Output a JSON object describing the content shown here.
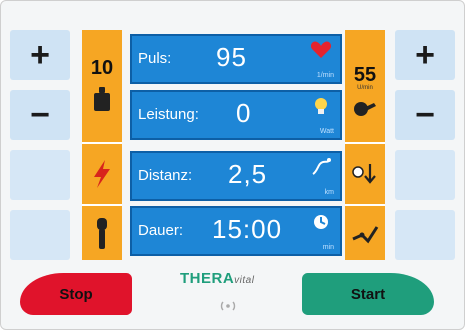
{
  "rows": [
    {
      "label": "Puls:",
      "value": "95",
      "unit": "1/min",
      "icon": "heart-icon"
    },
    {
      "label": "Leistung:",
      "value": "0",
      "unit": "Watt",
      "icon": "bulb-icon"
    },
    {
      "label": "Distanz:",
      "value": "2,5",
      "unit": "km",
      "icon": "distance-icon"
    },
    {
      "label": "Dauer:",
      "value": "15:00",
      "unit": "min",
      "icon": "timer-icon"
    }
  ],
  "left_keys": {
    "plus": "+",
    "minus": "−"
  },
  "right_keys": {
    "plus": "+",
    "minus": "−"
  },
  "left_level": "10",
  "right_level": "55",
  "right_level_unit": "U/min",
  "buttons": {
    "stop": "Stop",
    "start": "Start"
  },
  "brand": {
    "part1": "THERA",
    "part2": "vital"
  },
  "colors": {
    "display_blue": "#1e86d6",
    "orange": "#f6a623",
    "stop_red": "#e0132b",
    "start_green": "#1f9e7c"
  }
}
